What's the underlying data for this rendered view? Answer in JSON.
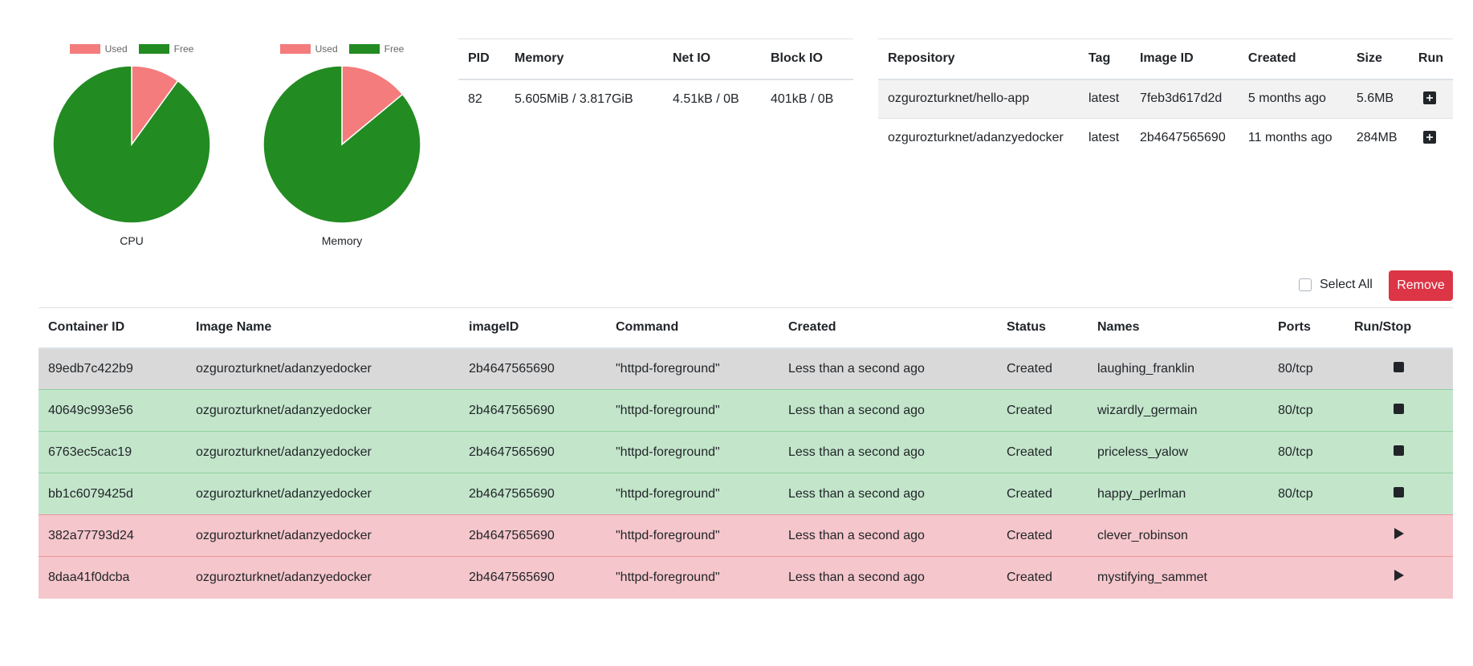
{
  "charts": {
    "colors": {
      "used": "#f47c7c",
      "free": "#228b22"
    },
    "legend": {
      "used_label": "Used",
      "free_label": "Free"
    },
    "cpu": {
      "label": "CPU"
    },
    "memory": {
      "label": "Memory"
    }
  },
  "chart_data": [
    {
      "type": "pie",
      "title": "",
      "label": "CPU",
      "categories": [
        "Used",
        "Free"
      ],
      "values": [
        10,
        90
      ]
    },
    {
      "type": "pie",
      "title": "",
      "label": "Memory",
      "categories": [
        "Used",
        "Free"
      ],
      "values": [
        14,
        86
      ]
    }
  ],
  "stats": {
    "headers": [
      "PID",
      "Memory",
      "Net IO",
      "Block IO"
    ],
    "rows": [
      {
        "pid": "82",
        "memory": "5.605MiB / 3.817GiB",
        "net_io": "4.51kB / 0B",
        "block_io": "401kB / 0B"
      }
    ]
  },
  "images": {
    "headers": [
      "Repository",
      "Tag",
      "Image ID",
      "Created",
      "Size",
      "Run"
    ],
    "rows": [
      {
        "repository": "ozgurozturknet/hello-app",
        "tag": "latest",
        "image_id": "7feb3d617d2d",
        "created": "5 months ago",
        "size": "5.6MB",
        "run_icon": "plus-square-icon"
      },
      {
        "repository": "ozgurozturknet/adanzyedocker",
        "tag": "latest",
        "image_id": "2b4647565690",
        "created": "11 months ago",
        "size": "284MB",
        "run_icon": "plus-square-icon"
      }
    ]
  },
  "controls": {
    "select_all_label": "Select All",
    "remove_label": "Remove",
    "remove_color": "#dc3545"
  },
  "containers": {
    "headers": [
      "Container ID",
      "Image Name",
      "imageID",
      "Command",
      "Created",
      "Status",
      "Names",
      "Ports",
      "Run/Stop"
    ],
    "rows": [
      {
        "container_id": "89edb7c422b9",
        "image_name": "ozgurozturknet/adanzyedocker",
        "image_id": "2b4647565690",
        "command": "\"httpd-foreground\"",
        "created": "Less than a second ago",
        "status": "Created",
        "names": "laughing_franklin",
        "ports": "80/tcp",
        "action": "stop",
        "row_color": "#d9d9d9"
      },
      {
        "container_id": "40649c993e56",
        "image_name": "ozgurozturknet/adanzyedocker",
        "image_id": "2b4647565690",
        "command": "\"httpd-foreground\"",
        "created": "Less than a second ago",
        "status": "Created",
        "names": "wizardly_germain",
        "ports": "80/tcp",
        "action": "stop",
        "row_color": "#c3e6cb"
      },
      {
        "container_id": "6763ec5cac19",
        "image_name": "ozgurozturknet/adanzyedocker",
        "image_id": "2b4647565690",
        "command": "\"httpd-foreground\"",
        "created": "Less than a second ago",
        "status": "Created",
        "names": "priceless_yalow",
        "ports": "80/tcp",
        "action": "stop",
        "row_color": "#c3e6cb"
      },
      {
        "container_id": "bb1c6079425d",
        "image_name": "ozgurozturknet/adanzyedocker",
        "image_id": "2b4647565690",
        "command": "\"httpd-foreground\"",
        "created": "Less than a second ago",
        "status": "Created",
        "names": "happy_perlman",
        "ports": "80/tcp",
        "action": "stop",
        "row_color": "#c3e6cb"
      },
      {
        "container_id": "382a77793d24",
        "image_name": "ozgurozturknet/adanzyedocker",
        "image_id": "2b4647565690",
        "command": "\"httpd-foreground\"",
        "created": "Less than a second ago",
        "status": "Created",
        "names": "clever_robinson",
        "ports": "",
        "action": "play",
        "row_color": "#f5c6cb"
      },
      {
        "container_id": "8daa41f0dcba",
        "image_name": "ozgurozturknet/adanzyedocker",
        "image_id": "2b4647565690",
        "command": "\"httpd-foreground\"",
        "created": "Less than a second ago",
        "status": "Created",
        "names": "mystifying_sammet",
        "ports": "",
        "action": "play",
        "row_color": "#f5c6cb"
      }
    ]
  }
}
